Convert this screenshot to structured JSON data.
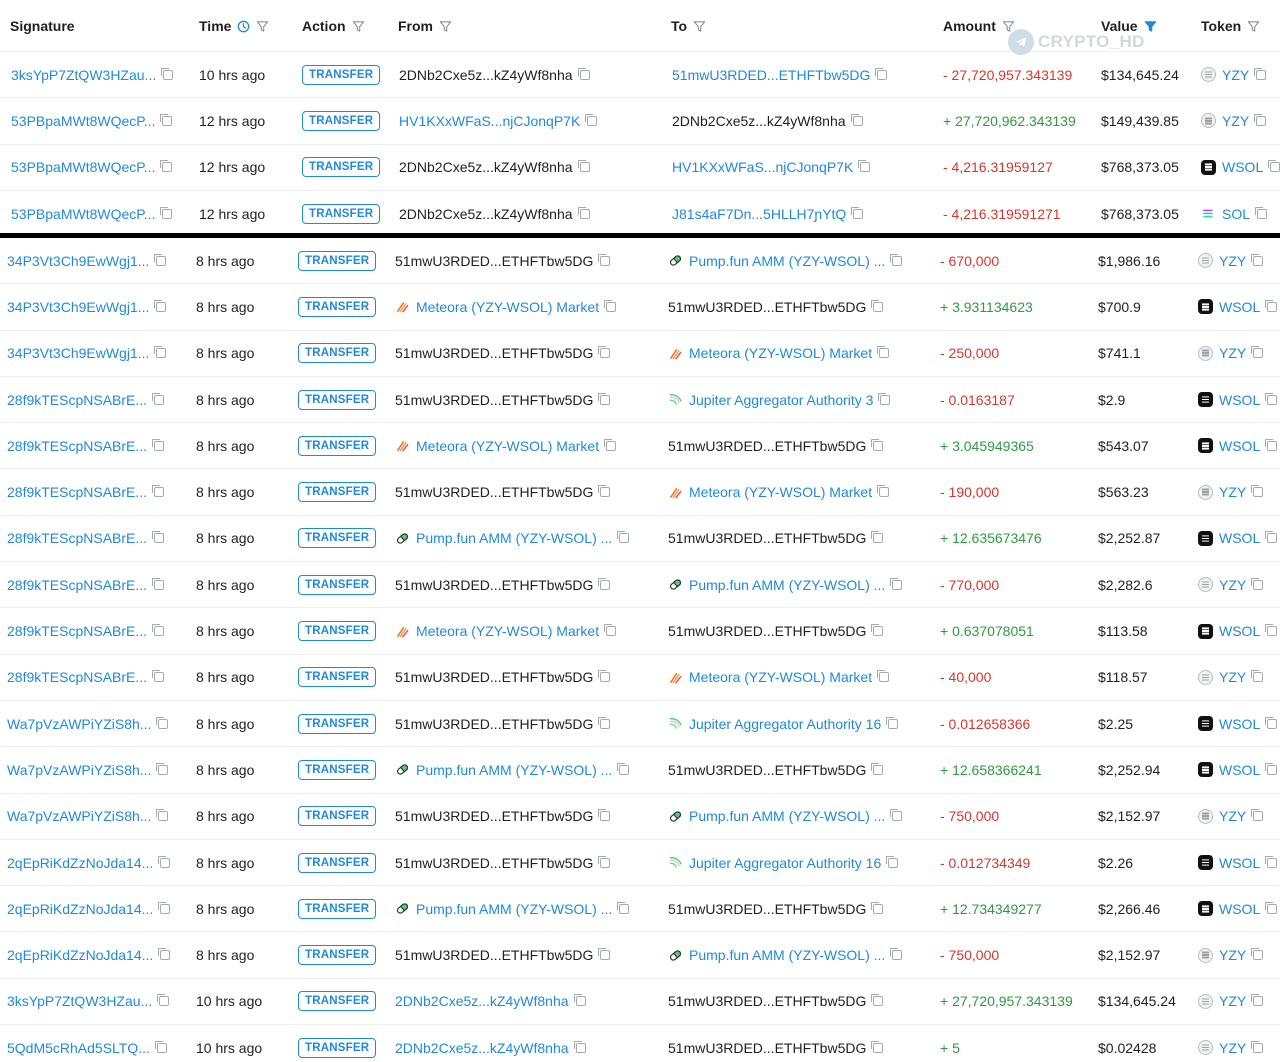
{
  "headers": {
    "signature": "Signature",
    "time": "Time",
    "action": "Action",
    "from": "From",
    "to": "To",
    "amount": "Amount",
    "value": "Value",
    "token": "Token"
  },
  "watermark": "CRYPTO_HD",
  "colors": {
    "link": "#1f8ad9",
    "negative": "#d8362c",
    "positive": "#2e9c3e",
    "filter_active": "#1f8ad9"
  },
  "top_rows": [
    {
      "signature": "3ksYpP7ZtQW3HZau...",
      "time": "10 hrs ago",
      "action": "TRANSFER",
      "from": {
        "text": "2DNb2Cxe5z...kZ4yWf8nha",
        "link": false,
        "icon": ""
      },
      "to": {
        "text": "51mwU3RDED...ETHFTbw5DG",
        "link": true,
        "icon": ""
      },
      "amount": "- 27,720,957.343139",
      "sign": "neg",
      "value": "$134,645.24",
      "token": "YZY",
      "token_icon": "yzy"
    },
    {
      "signature": "53PBpaMWt8WQecP...",
      "time": "12 hrs ago",
      "action": "TRANSFER",
      "from": {
        "text": "HV1KXxWFaS...njCJonqP7K",
        "link": true,
        "icon": ""
      },
      "to": {
        "text": "2DNb2Cxe5z...kZ4yWf8nha",
        "link": false,
        "icon": ""
      },
      "amount": "+ 27,720,962.343139",
      "sign": "pos",
      "value": "$149,439.85",
      "token": "YZY",
      "token_icon": "yzy"
    },
    {
      "signature": "53PBpaMWt8WQecP...",
      "time": "12 hrs ago",
      "action": "TRANSFER",
      "from": {
        "text": "2DNb2Cxe5z...kZ4yWf8nha",
        "link": false,
        "icon": ""
      },
      "to": {
        "text": "HV1KXxWFaS...njCJonqP7K",
        "link": true,
        "icon": ""
      },
      "amount": "- 4,216.31959127",
      "sign": "neg",
      "value": "$768,373.05",
      "token": "WSOL",
      "token_icon": "wsol"
    },
    {
      "signature": "53PBpaMWt8WQecP...",
      "time": "12 hrs ago",
      "action": "TRANSFER",
      "from": {
        "text": "2DNb2Cxe5z...kZ4yWf8nha",
        "link": false,
        "icon": ""
      },
      "to": {
        "text": "J81s4aF7Dn...5HLLH7ɲYtQ",
        "link": true,
        "icon": ""
      },
      "amount": "- 4,216.319591271",
      "sign": "neg",
      "value": "$768,373.05",
      "token": "SOL",
      "token_icon": "sol"
    }
  ],
  "bottom_rows": [
    {
      "signature": "34P3Vt3Ch9EwWgj1...",
      "time": "8 hrs ago",
      "action": "TRANSFER",
      "from": {
        "text": "51mwU3RDED...ETHFTbw5DG",
        "link": false,
        "icon": ""
      },
      "to": {
        "text": "Pump.fun AMM (YZY-WSOL) ...",
        "link": true,
        "icon": "pump"
      },
      "amount": "- 670,000",
      "sign": "neg",
      "value": "$1,986.16",
      "token": "YZY",
      "token_icon": "yzy"
    },
    {
      "signature": "34P3Vt3Ch9EwWgj1...",
      "time": "8 hrs ago",
      "action": "TRANSFER",
      "from": {
        "text": "Meteora (YZY-WSOL) Market",
        "link": true,
        "icon": "meteora"
      },
      "to": {
        "text": "51mwU3RDED...ETHFTbw5DG",
        "link": false,
        "icon": ""
      },
      "amount": "+ 3.931134623",
      "sign": "pos",
      "value": "$700.9",
      "token": "WSOL",
      "token_icon": "wsol"
    },
    {
      "signature": "34P3Vt3Ch9EwWgj1...",
      "time": "8 hrs ago",
      "action": "TRANSFER",
      "from": {
        "text": "51mwU3RDED...ETHFTbw5DG",
        "link": false,
        "icon": ""
      },
      "to": {
        "text": "Meteora (YZY-WSOL) Market",
        "link": true,
        "icon": "meteora"
      },
      "amount": "- 250,000",
      "sign": "neg",
      "value": "$741.1",
      "token": "YZY",
      "token_icon": "yzy"
    },
    {
      "signature": "28f9kTEScpNSABrE...",
      "time": "8 hrs ago",
      "action": "TRANSFER",
      "from": {
        "text": "51mwU3RDED...ETHFTbw5DG",
        "link": false,
        "icon": ""
      },
      "to": {
        "text": "Jupiter Aggregator Authority 3",
        "link": true,
        "icon": "jupiter"
      },
      "amount": "- 0.0163187",
      "sign": "neg",
      "value": "$2.9",
      "token": "WSOL",
      "token_icon": "wsol"
    },
    {
      "signature": "28f9kTEScpNSABrE...",
      "time": "8 hrs ago",
      "action": "TRANSFER",
      "from": {
        "text": "Meteora (YZY-WSOL) Market",
        "link": true,
        "icon": "meteora"
      },
      "to": {
        "text": "51mwU3RDED...ETHFTbw5DG",
        "link": false,
        "icon": ""
      },
      "amount": "+ 3.045949365",
      "sign": "pos",
      "value": "$543.07",
      "token": "WSOL",
      "token_icon": "wsol"
    },
    {
      "signature": "28f9kTEScpNSABrE...",
      "time": "8 hrs ago",
      "action": "TRANSFER",
      "from": {
        "text": "51mwU3RDED...ETHFTbw5DG",
        "link": false,
        "icon": ""
      },
      "to": {
        "text": "Meteora (YZY-WSOL) Market",
        "link": true,
        "icon": "meteora"
      },
      "amount": "- 190,000",
      "sign": "neg",
      "value": "$563.23",
      "token": "YZY",
      "token_icon": "yzy"
    },
    {
      "signature": "28f9kTEScpNSABrE...",
      "time": "8 hrs ago",
      "action": "TRANSFER",
      "from": {
        "text": "Pump.fun AMM (YZY-WSOL) ...",
        "link": true,
        "icon": "pump"
      },
      "to": {
        "text": "51mwU3RDED...ETHFTbw5DG",
        "link": false,
        "icon": ""
      },
      "amount": "+ 12.635673476",
      "sign": "pos",
      "value": "$2,252.87",
      "token": "WSOL",
      "token_icon": "wsol"
    },
    {
      "signature": "28f9kTEScpNSABrE...",
      "time": "8 hrs ago",
      "action": "TRANSFER",
      "from": {
        "text": "51mwU3RDED...ETHFTbw5DG",
        "link": false,
        "icon": ""
      },
      "to": {
        "text": "Pump.fun AMM (YZY-WSOL) ...",
        "link": true,
        "icon": "pump"
      },
      "amount": "- 770,000",
      "sign": "neg",
      "value": "$2,282.6",
      "token": "YZY",
      "token_icon": "yzy"
    },
    {
      "signature": "28f9kTEScpNSABrE...",
      "time": "8 hrs ago",
      "action": "TRANSFER",
      "from": {
        "text": "Meteora (YZY-WSOL) Market",
        "link": true,
        "icon": "meteora"
      },
      "to": {
        "text": "51mwU3RDED...ETHFTbw5DG",
        "link": false,
        "icon": ""
      },
      "amount": "+ 0.637078051",
      "sign": "pos",
      "value": "$113.58",
      "token": "WSOL",
      "token_icon": "wsol"
    },
    {
      "signature": "28f9kTEScpNSABrE...",
      "time": "8 hrs ago",
      "action": "TRANSFER",
      "from": {
        "text": "51mwU3RDED...ETHFTbw5DG",
        "link": false,
        "icon": ""
      },
      "to": {
        "text": "Meteora (YZY-WSOL) Market",
        "link": true,
        "icon": "meteora"
      },
      "amount": "- 40,000",
      "sign": "neg",
      "value": "$118.57",
      "token": "YZY",
      "token_icon": "yzy"
    },
    {
      "signature": "Wa7pVzAWPiYZiS8h...",
      "time": "8 hrs ago",
      "action": "TRANSFER",
      "from": {
        "text": "51mwU3RDED...ETHFTbw5DG",
        "link": false,
        "icon": ""
      },
      "to": {
        "text": "Jupiter Aggregator Authority 16",
        "link": true,
        "icon": "jupiter"
      },
      "amount": "- 0.012658366",
      "sign": "neg",
      "value": "$2.25",
      "token": "WSOL",
      "token_icon": "wsol"
    },
    {
      "signature": "Wa7pVzAWPiYZiS8h...",
      "time": "8 hrs ago",
      "action": "TRANSFER",
      "from": {
        "text": "Pump.fun AMM (YZY-WSOL) ...",
        "link": true,
        "icon": "pump"
      },
      "to": {
        "text": "51mwU3RDED...ETHFTbw5DG",
        "link": false,
        "icon": ""
      },
      "amount": "+ 12.658366241",
      "sign": "pos",
      "value": "$2,252.94",
      "token": "WSOL",
      "token_icon": "wsol"
    },
    {
      "signature": "Wa7pVzAWPiYZiS8h...",
      "time": "8 hrs ago",
      "action": "TRANSFER",
      "from": {
        "text": "51mwU3RDED...ETHFTbw5DG",
        "link": false,
        "icon": ""
      },
      "to": {
        "text": "Pump.fun AMM (YZY-WSOL) ...",
        "link": true,
        "icon": "pump"
      },
      "amount": "- 750,000",
      "sign": "neg",
      "value": "$2,152.97",
      "token": "YZY",
      "token_icon": "yzy"
    },
    {
      "signature": "2qEpRiKdZzNoJda14...",
      "time": "8 hrs ago",
      "action": "TRANSFER",
      "from": {
        "text": "51mwU3RDED...ETHFTbw5DG",
        "link": false,
        "icon": ""
      },
      "to": {
        "text": "Jupiter Aggregator Authority 16",
        "link": true,
        "icon": "jupiter"
      },
      "amount": "- 0.012734349",
      "sign": "neg",
      "value": "$2.26",
      "token": "WSOL",
      "token_icon": "wsol"
    },
    {
      "signature": "2qEpRiKdZzNoJda14...",
      "time": "8 hrs ago",
      "action": "TRANSFER",
      "from": {
        "text": "Pump.fun AMM (YZY-WSOL) ...",
        "link": true,
        "icon": "pump"
      },
      "to": {
        "text": "51mwU3RDED...ETHFTbw5DG",
        "link": false,
        "icon": ""
      },
      "amount": "+ 12.734349277",
      "sign": "pos",
      "value": "$2,266.46",
      "token": "WSOL",
      "token_icon": "wsol"
    },
    {
      "signature": "2qEpRiKdZzNoJda14...",
      "time": "8 hrs ago",
      "action": "TRANSFER",
      "from": {
        "text": "51mwU3RDED...ETHFTbw5DG",
        "link": false,
        "icon": ""
      },
      "to": {
        "text": "Pump.fun AMM (YZY-WSOL) ...",
        "link": true,
        "icon": "pump"
      },
      "amount": "- 750,000",
      "sign": "neg",
      "value": "$2,152.97",
      "token": "YZY",
      "token_icon": "yzy"
    },
    {
      "signature": "3ksYpP7ZtQW3HZau...",
      "time": "10 hrs ago",
      "action": "TRANSFER",
      "from": {
        "text": "2DNb2Cxe5z...kZ4yWf8nha",
        "link": true,
        "icon": ""
      },
      "to": {
        "text": "51mwU3RDED...ETHFTbw5DG",
        "link": false,
        "icon": ""
      },
      "amount": "+ 27,720,957.343139",
      "sign": "pos",
      "value": "$134,645.24",
      "token": "YZY",
      "token_icon": "yzy"
    },
    {
      "signature": "5QdM5cRhAd5SLTQ...",
      "time": "10 hrs ago",
      "action": "TRANSFER",
      "from": {
        "text": "2DNb2Cxe5z...kZ4yWf8nha",
        "link": true,
        "icon": ""
      },
      "to": {
        "text": "51mwU3RDED...ETHFTbw5DG",
        "link": false,
        "icon": ""
      },
      "amount": "+ 5",
      "sign": "pos",
      "value": "$0.02428",
      "token": "YZY",
      "token_icon": "yzy"
    }
  ]
}
